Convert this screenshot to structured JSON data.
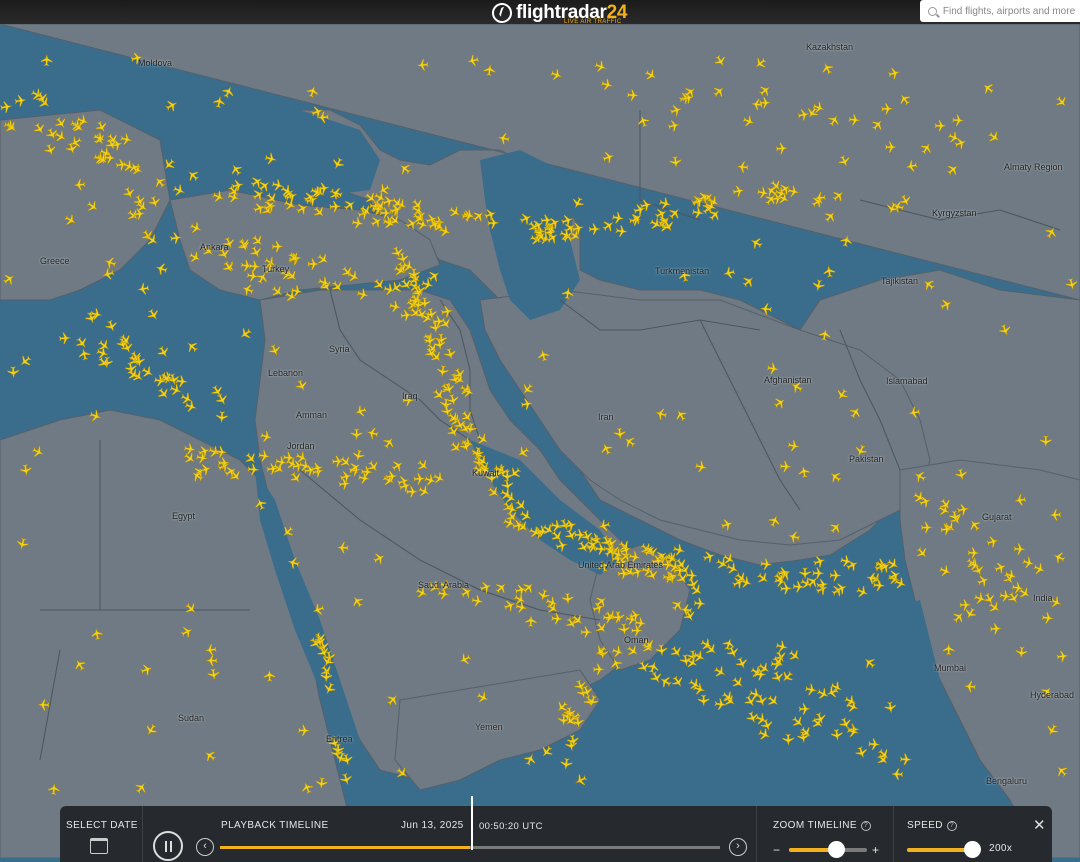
{
  "header": {
    "brand_main": "flightradar",
    "brand_num": "24",
    "tagline": "LIVE AIR TRAFFIC",
    "search_placeholder": "Find flights, airports and more"
  },
  "map": {
    "water_color": "#3a6d8c",
    "land_color": "#6f7a84",
    "aircraft_color": "#f3d21a",
    "countries": [
      {
        "name": "Moldova"
      },
      {
        "name": "Kazakhstan"
      },
      {
        "name": "Almaty Region"
      },
      {
        "name": "Kyrgyzstan"
      },
      {
        "name": "Turkey"
      },
      {
        "name": "Ankara"
      },
      {
        "name": "Greece"
      },
      {
        "name": "Turkmenistan"
      },
      {
        "name": "Tajikistan"
      },
      {
        "name": "Syria"
      },
      {
        "name": "Lebanon"
      },
      {
        "name": "Amman"
      },
      {
        "name": "Jordan"
      },
      {
        "name": "Iraq"
      },
      {
        "name": "Iran"
      },
      {
        "name": "Afghanistan"
      },
      {
        "name": "Islamabad"
      },
      {
        "name": "Kuwait"
      },
      {
        "name": "Pakistan"
      },
      {
        "name": "Egypt"
      },
      {
        "name": "United Arab Emirates"
      },
      {
        "name": "Saudi Arabia"
      },
      {
        "name": "Oman"
      },
      {
        "name": "India"
      },
      {
        "name": "Mumbai"
      },
      {
        "name": "Hyderabad"
      },
      {
        "name": "Sudan"
      },
      {
        "name": "Eritrea"
      },
      {
        "name": "Yemen"
      },
      {
        "name": "Bengaluru"
      },
      {
        "name": "Gujarat"
      }
    ]
  },
  "controls": {
    "select_date_label": "SELECT DATE",
    "playback_label": "PLAYBACK TIMELINE",
    "date": "Jun 13, 2025",
    "time": "00:50:20 UTC",
    "zoom_label": "ZOOM TIMELINE",
    "zoom_minus": "−",
    "zoom_plus": "+",
    "zoom_level": 0.6,
    "speed_label": "SPEED",
    "speed_value": "200x",
    "speed_level": 0.95,
    "playback_progress": 0.5,
    "info_glyph": "?",
    "close_glyph": "✕",
    "prev_glyph": "‹",
    "next_glyph": "›"
  }
}
